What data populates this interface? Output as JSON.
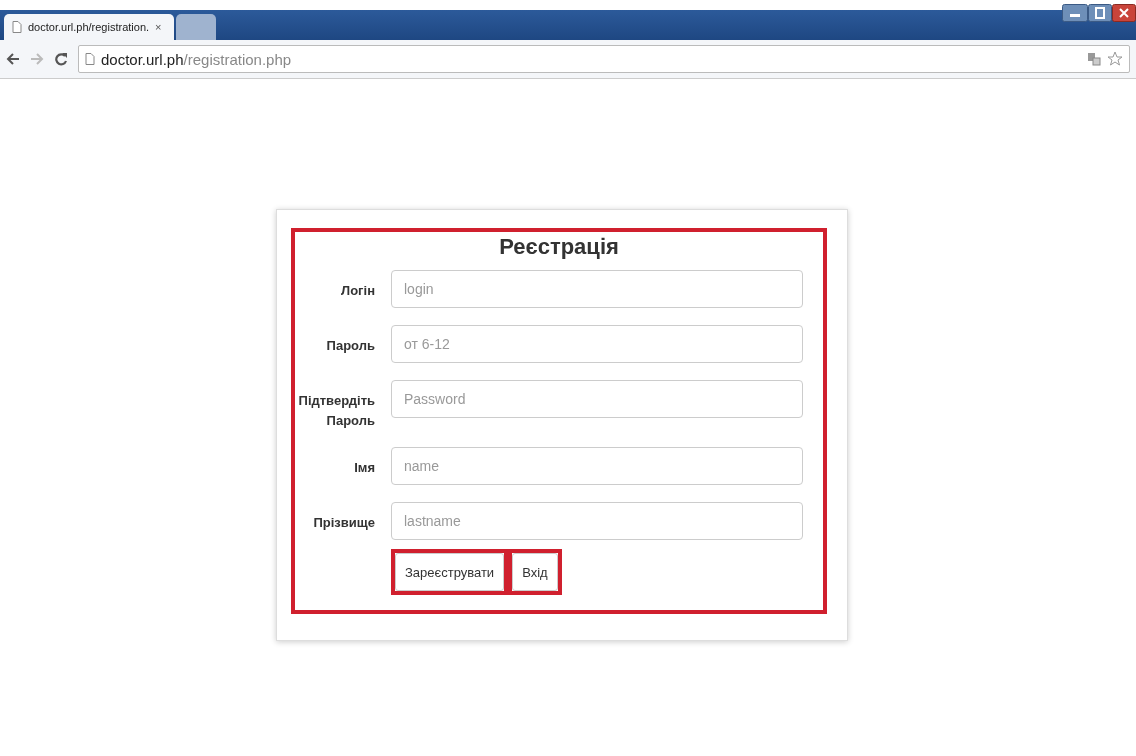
{
  "browser": {
    "tabs": [
      {
        "title": "doctor.url.ph/registration.",
        "selected": true,
        "close": "×"
      },
      {
        "selected": false
      }
    ],
    "address": {
      "host": "doctor.url.ph",
      "path": "/registration.php"
    }
  },
  "form": {
    "title": "Реєстрація",
    "highlighted": true,
    "fields": [
      {
        "label": "Логін",
        "placeholder": "login"
      },
      {
        "label": "Пароль",
        "placeholder": "от 6-12"
      },
      {
        "label": "Підтвердіть Пароль",
        "placeholder": "Password"
      },
      {
        "label": "Імя",
        "placeholder": "name"
      },
      {
        "label": "Прізвище",
        "placeholder": "lastname"
      }
    ],
    "buttons": [
      {
        "label": "Зареєструвати",
        "highlighted": true
      },
      {
        "label": "Вхід",
        "highlighted": true
      }
    ]
  }
}
